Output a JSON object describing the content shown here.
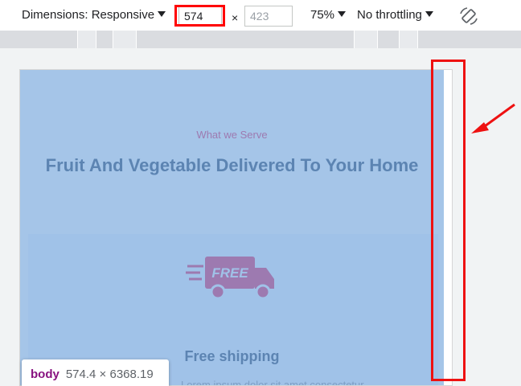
{
  "toolbar": {
    "dimensions_label": "Dimensions: Responsive",
    "width_value": "574",
    "times_symbol": "×",
    "height_value": "423",
    "zoom_label": "75%",
    "throttling_label": "No throttling",
    "rotate_icon": "rotate-device-icon"
  },
  "page": {
    "eyebrow": "What we Serve",
    "headline": "Fruit And Vegetable Delivered To Your Home",
    "truck_badge": "FREE",
    "card_title": "Free shipping",
    "card_sub": "Lorem ipsum dolor sit amet consectetur"
  },
  "tooltip": {
    "tag": "body",
    "dimensions": "574.4 × 6368.19"
  },
  "colors": {
    "annotation_red": "#ee1111",
    "highlight_overlay": "#a5c5e8",
    "tag_purple": "#881280"
  }
}
